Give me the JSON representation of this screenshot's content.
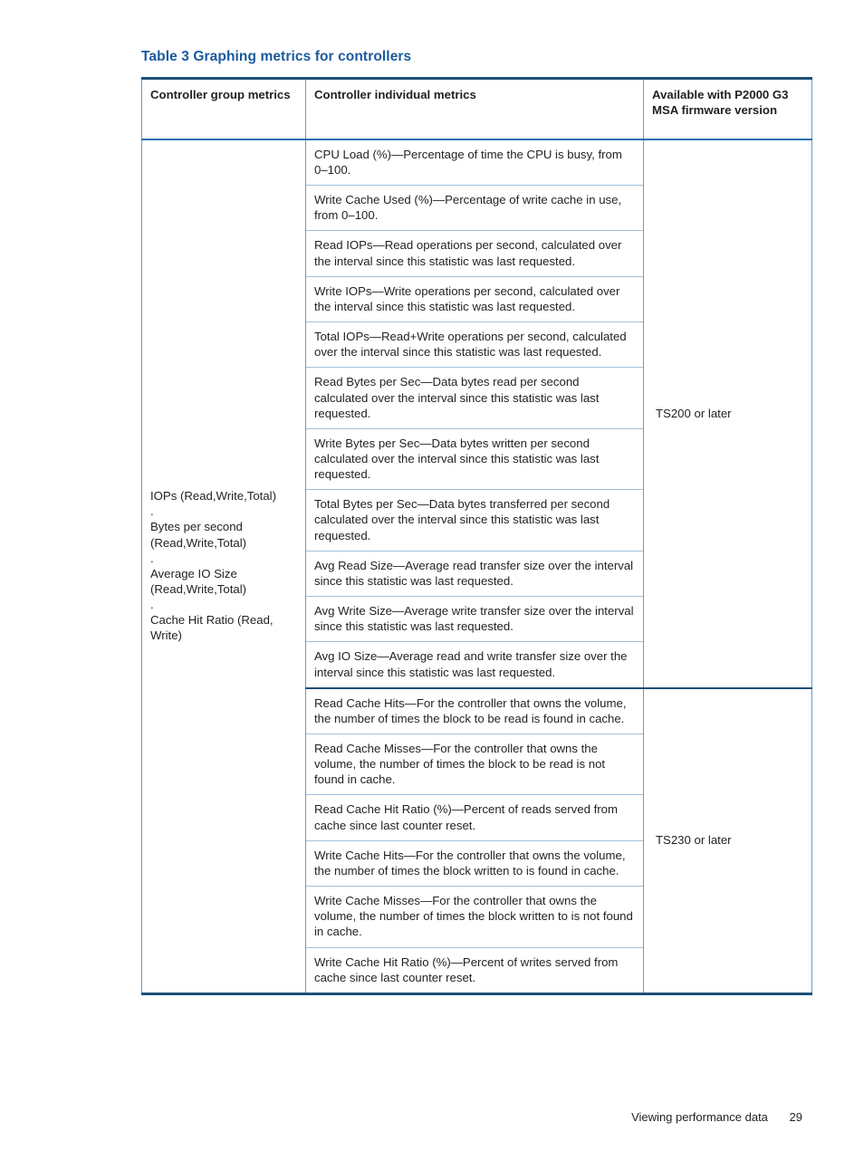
{
  "document": {
    "table_title": "Table 3 Graphing metrics for controllers",
    "accent_color": "#1a5a9e",
    "border_color": "#1f4e79",
    "rule_color": "#9dc0dc"
  },
  "table": {
    "headers": {
      "col1": "Controller group metrics",
      "col2": "Controller individual metrics",
      "col3": "Available with P2000 G3 MSA firmware version"
    },
    "group_metrics": {
      "items": [
        "IOPs (Read,Write,Total)",
        "Bytes per second (Read,Write,Total)",
        "Average IO Size (Read,Write,Total)",
        "Cache Hit Ratio (Read, Write)"
      ],
      "lines": [
        "IOPs (Read,Write,Total)",
        ".",
        "Bytes per second",
        "(Read,Write,Total)",
        ".",
        "Average IO Size",
        "(Read,Write,Total)",
        ".",
        "Cache Hit Ratio (Read,",
        "Write)"
      ],
      "separator": "."
    },
    "firmware_groups": [
      {
        "label": "TS200 or later",
        "row_count": 10
      },
      {
        "label": "TS230 or later",
        "row_count": 6
      }
    ],
    "individual_metrics": [
      "CPU Load (%)—Percentage of time the CPU is busy, from 0–100.",
      "Write Cache Used (%)—Percentage of write cache in use, from 0–100.",
      "Read IOPs—Read operations per second, calculated over the interval since this statistic was last requested.",
      "Write IOPs—Write operations per second, calculated over the interval since this statistic was last requested.",
      "Total IOPs—Read+Write operations per second, calculated over the interval since this statistic was last requested.",
      "Read Bytes per Sec—Data bytes read per second calculated over the interval since this statistic was last requested.",
      "Write Bytes per Sec—Data bytes written per second calculated over the interval since this statistic was last requested.",
      "Total Bytes per Sec—Data bytes transferred per second calculated over the interval since this statistic was last requested.",
      "Avg Read Size—Average read transfer size over the interval since this statistic was last requested.",
      "Avg Write Size—Average write transfer size over the interval since this statistic was last requested.",
      "Avg IO Size—Average read and write transfer size over the interval since this statistic was last requested.",
      "Read Cache Hits—For the controller that owns the volume, the number of times the block to be read is found in cache.",
      "Read Cache Misses—For the controller that owns the volume, the number of times the block to be read is not found in cache.",
      "Read Cache Hit Ratio (%)—Percent of reads served from cache since last counter reset.",
      "Write Cache Hits—For the controller that owns the volume, the number of times the block written to is found in cache.",
      "Write Cache Misses—For the controller that owns the volume, the number of times the block written to is not found in cache.",
      "Write Cache Hit Ratio (%)—Percent of writes served from cache since last counter reset."
    ]
  },
  "footer": {
    "section_title": "Viewing performance data",
    "page_number": "29"
  }
}
